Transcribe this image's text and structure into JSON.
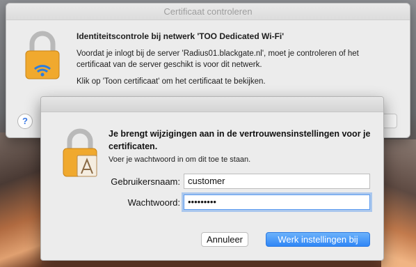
{
  "back_dialog": {
    "title": "Certificaat controleren",
    "heading": "Identiteitscontrole bij netwerk 'TOO Dedicated Wi-Fi'",
    "body": "Voordat je inlogt bij de server 'Radius01.blackgate.nl', moet je controleren of het certificaat van de server geschikt is voor dit netwerk.",
    "hint": "Klik op 'Toon certificaat' om het certificaat te bekijken.",
    "help_label": "?"
  },
  "auth_dialog": {
    "heading": "Je brengt wijzigingen aan in de vertrouwensinstellingen voor je certificaten.",
    "subtext": "Voer je wachtwoord in om dit toe te staan.",
    "username_label": "Gebruikersnaam:",
    "username_value": "customer",
    "password_label": "Wachtwoord:",
    "password_value": "•••••••••",
    "cancel_label": "Annuleer",
    "confirm_label": "Werk instellingen bij"
  },
  "colors": {
    "accent": "#2f86f6",
    "lock_gold": "#f0a92e",
    "wifi_blue": "#2b7de0"
  }
}
